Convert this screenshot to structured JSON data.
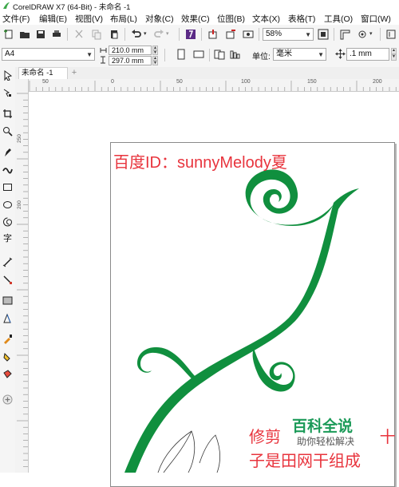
{
  "window": {
    "title": "CorelDRAW X7 (64-Bit) - 未命名 -1"
  },
  "menu": {
    "items": [
      "文件(F)",
      "编辑(E)",
      "视图(V)",
      "布局(L)",
      "对象(C)",
      "效果(C)",
      "位图(B)",
      "文本(X)",
      "表格(T)",
      "工具(O)",
      "窗口(W)"
    ]
  },
  "toolbar": {
    "zoom": "58%"
  },
  "property_bar": {
    "paper": "A4",
    "width": "210.0 mm",
    "height": "297.0 mm",
    "units_label": "单位:",
    "units": "毫米",
    "nudge": ".1 mm"
  },
  "doc_tab": {
    "label": "未命名 -1",
    "add": "+"
  },
  "ruler": {
    "h_labels": [
      "50",
      "0",
      "50",
      "100",
      "150",
      "200"
    ],
    "v_labels": [
      "250",
      "200"
    ]
  },
  "canvas": {
    "caption": "百度ID：sunnyMelody夏",
    "bottom_line1": "修剪",
    "bottom_line1_end": "十",
    "bottom_line2": "子是田网干组成"
  },
  "watermark": {
    "title": "百科全说",
    "subtitle": "助你轻松解决"
  },
  "colors": {
    "accent_red": "#e8343d",
    "vine_green": "#108f3e",
    "watermark_green": "#1b9a58"
  }
}
